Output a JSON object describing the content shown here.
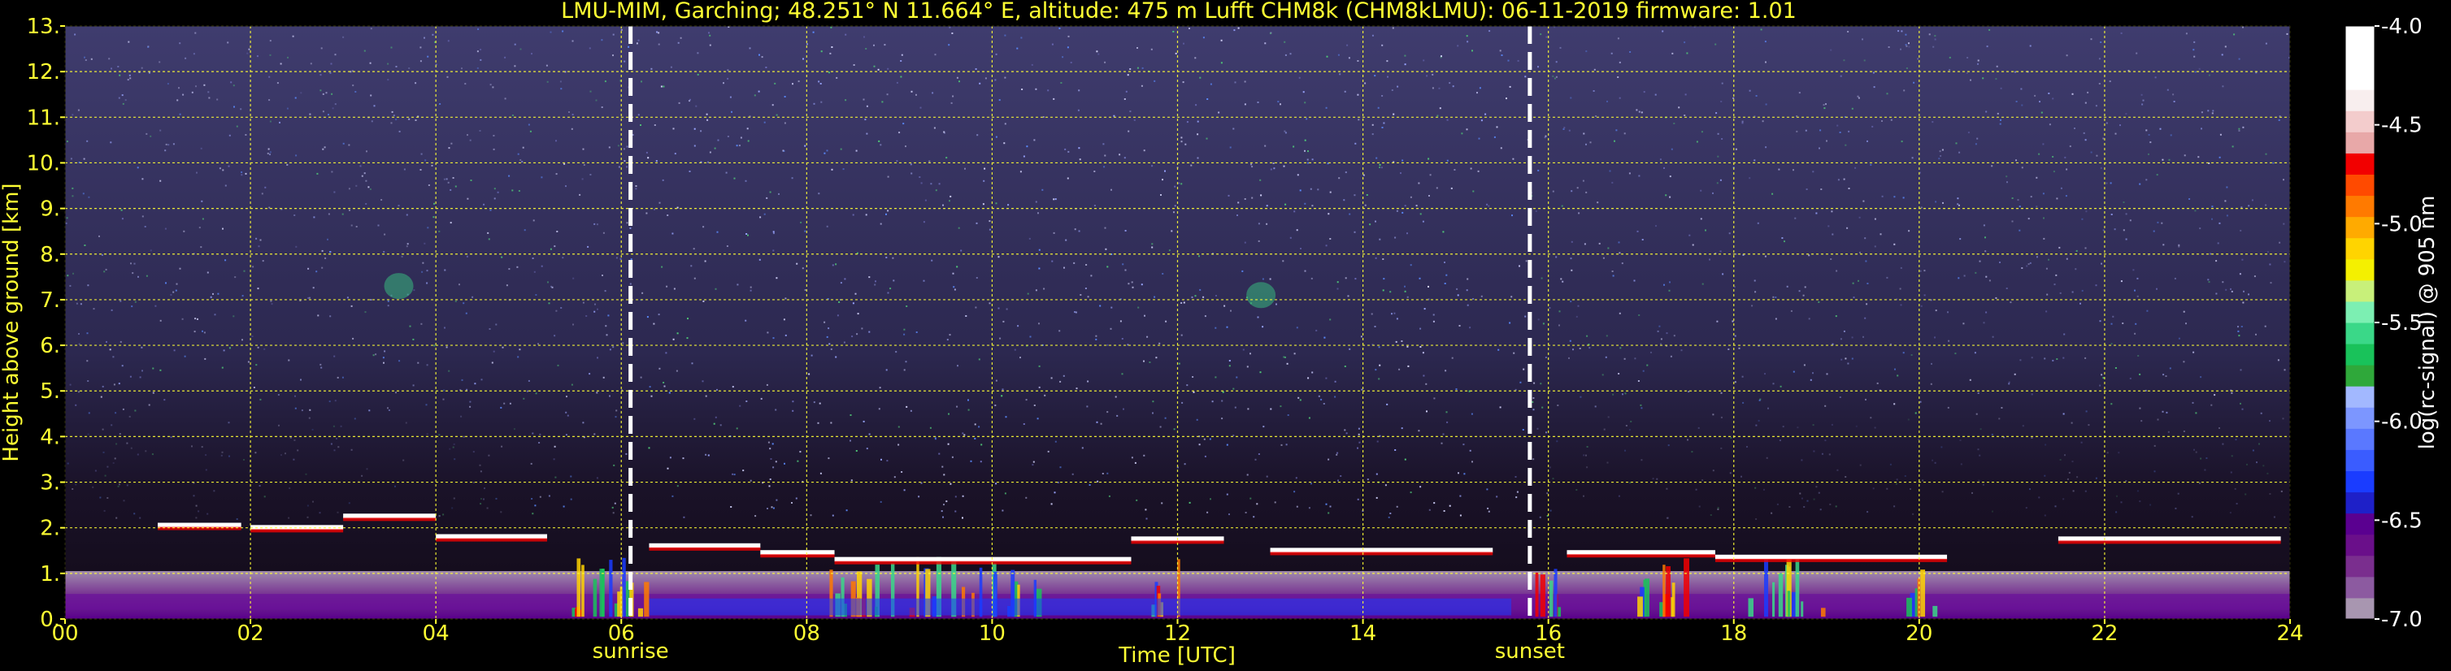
{
  "title": "LMU-MIM, Garching; 48.251° N 11.664° E, altitude: 475 m    Lufft CHM8k (CHM8kLMU): 06-11-2019    firmware: 1.01",
  "colors": {
    "background": "#000000",
    "text": "#ffff33",
    "grid": "#ffff33",
    "colorbar_text": "#ffffff",
    "markers": "#ffffff"
  },
  "chart_data": {
    "type": "heatmap",
    "xlabel": "Time [UTC]",
    "ylabel": "Height above ground [km]",
    "xlim": [
      0,
      24
    ],
    "ylim": [
      0,
      13
    ],
    "x_ticks": [
      "00",
      "02",
      "04",
      "06",
      "08",
      "10",
      "12",
      "14",
      "16",
      "18",
      "20",
      "22",
      "24"
    ],
    "y_ticks": [
      "0.",
      "1.",
      "2.",
      "3.",
      "4.",
      "5.",
      "6.",
      "7.",
      "8.",
      "9.",
      "10.",
      "11.",
      "12.",
      "13."
    ],
    "grid": true,
    "markers": [
      {
        "label": "sunrise",
        "time_utc": 6.1
      },
      {
        "label": "sunset",
        "time_utc": 15.8
      }
    ],
    "colorbar": {
      "label": "log(rc-signal) @ 905 nm",
      "range": [
        -7.0,
        -4.0
      ],
      "ticks": [
        "-4.0",
        "-4.5",
        "-5.0",
        "-5.5",
        "-6.0",
        "-6.5",
        "-7.0"
      ],
      "tick_values": [
        -4.0,
        -4.5,
        -5.0,
        -5.5,
        -6.0,
        -6.5,
        -7.0
      ],
      "colors": [
        "#a896b0",
        "#8c5aa0",
        "#7a2e8e",
        "#6a0f8a",
        "#5a0090",
        "#1e20c8",
        "#1a3cff",
        "#3a5cff",
        "#5a78ff",
        "#7c96ff",
        "#a2b8ff",
        "#2fa83a",
        "#19c25a",
        "#3ad888",
        "#7cefb2",
        "#c8f07a",
        "#f4f000",
        "#ffd400",
        "#ffaa00",
        "#ff7a00",
        "#ff4a00",
        "#f20000",
        "#e8a8a8",
        "#f3cccc",
        "#f8eeee",
        "#ffffff",
        "#ffffff",
        "#ffffff"
      ]
    },
    "cloud_base_layer_km": [
      {
        "from": 1.0,
        "to": 1.9,
        "height": 2.05
      },
      {
        "from": 2.0,
        "to": 3.0,
        "height": 2.0
      },
      {
        "from": 3.0,
        "to": 4.0,
        "height": 2.25
      },
      {
        "from": 4.0,
        "to": 5.2,
        "height": 1.8
      },
      {
        "from": 6.3,
        "to": 7.5,
        "height": 1.6
      },
      {
        "from": 7.5,
        "to": 8.3,
        "height": 1.45
      },
      {
        "from": 8.3,
        "to": 11.5,
        "height": 1.3
      },
      {
        "from": 11.5,
        "to": 12.5,
        "height": 1.75
      },
      {
        "from": 13.0,
        "to": 15.4,
        "height": 1.5
      },
      {
        "from": 16.2,
        "to": 17.8,
        "height": 1.45
      },
      {
        "from": 17.8,
        "to": 20.3,
        "height": 1.35
      },
      {
        "from": 21.5,
        "to": 23.9,
        "height": 1.75
      }
    ],
    "elevated_layers_km": [
      {
        "time": 3.6,
        "height": 7.3
      },
      {
        "time": 12.9,
        "height": 7.1
      }
    ],
    "noise_region_top_km": 13
  }
}
